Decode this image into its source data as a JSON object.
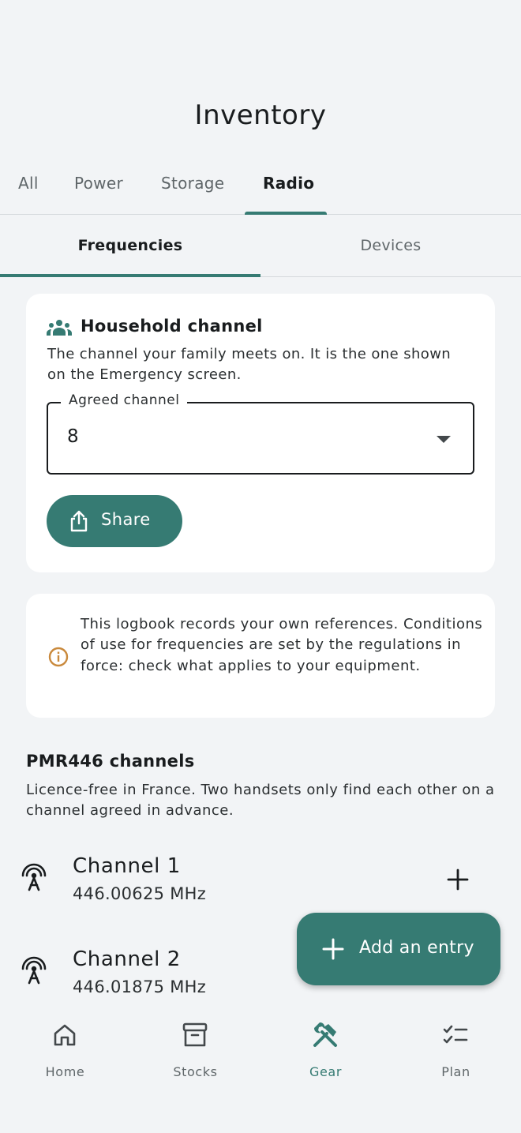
{
  "page": {
    "title": "Inventory"
  },
  "tabs_top": [
    "All",
    "Power",
    "Storage",
    "Radio"
  ],
  "tabs_sub": [
    "Frequencies",
    "Devices"
  ],
  "household": {
    "title": "Household channel",
    "description": "The channel your family meets on. It is the one shown on the Emergency screen.",
    "field_label": "Agreed channel",
    "field_value": "8",
    "share_label": "Share"
  },
  "info": {
    "text": "This logbook records your own references. Conditions of use for frequencies are set by the regulations in force: check what applies to your equipment."
  },
  "section": {
    "title": "PMR446 channels",
    "description": "Licence-free in France. Two handsets only find each other on a channel agreed in advance."
  },
  "channels": [
    {
      "name": "Channel 1",
      "frequency": "446.00625 MHz"
    },
    {
      "name": "Channel 2",
      "frequency": "446.01875 MHz"
    }
  ],
  "fab": {
    "label": "Add an entry"
  },
  "nav": [
    {
      "label": "Home",
      "icon": "home-icon"
    },
    {
      "label": "Stocks",
      "icon": "archive-icon"
    },
    {
      "label": "Gear",
      "icon": "tools-icon"
    },
    {
      "label": "Plan",
      "icon": "checklist-icon"
    }
  ],
  "colors": {
    "accent": "#367b73",
    "background": "#f2f4f6",
    "card": "#ffffff",
    "info_icon": "#c9893c"
  }
}
